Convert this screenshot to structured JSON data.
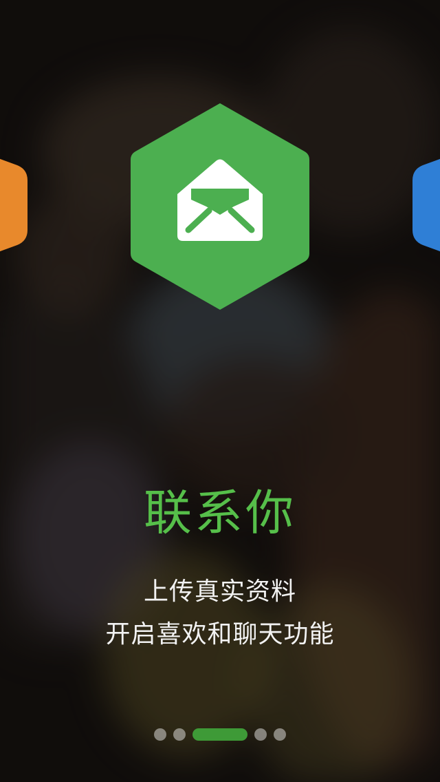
{
  "hero": {
    "title": "联系你",
    "lines": [
      "上传真实资料",
      "开启喜欢和聊天功能"
    ]
  },
  "icons": {
    "left": "hexagon-orange-icon",
    "center": "envelope-icon",
    "right": "hexagon-blue-icon"
  },
  "colors": {
    "accent": "#4caf50",
    "title": "#56bf4a",
    "left_hex": "#e8892c",
    "right_hex": "#2f7fd6",
    "active_dot": "#3e9a37"
  },
  "pager": {
    "total": 5,
    "current": 3
  }
}
